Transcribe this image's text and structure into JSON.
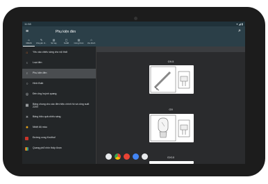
{
  "statusbar": {
    "time": "11:58",
    "icons": "▾ ◢ ▮"
  },
  "appbar": {
    "menu_glyph": "≡",
    "title": "Phụ kiện đèn",
    "search_glyph": "⌕"
  },
  "tabs": [
    {
      "icon": "⌂",
      "label": "Chính",
      "active": true
    },
    {
      "icon": "✎",
      "label": "Chuyển đ..."
    },
    {
      "icon": "▤",
      "label": "Sổ tay"
    },
    {
      "icon": "▢",
      "label": "Sơđồ"
    },
    {
      "icon": "▤",
      "label": "Công thức"
    },
    {
      "icon": "☆",
      "label": "Ưa thích"
    }
  ],
  "sidebar": {
    "items": [
      {
        "label": "Yêu cầu chiếu sáng cho nội thất",
        "icon_name": "house-icon",
        "color": "#e8742b"
      },
      {
        "label": "Loại đèn",
        "icon_name": "bulbs-icon",
        "color": "#cfd3d6"
      },
      {
        "label": "Phụ kiện đèn",
        "icon_name": "lamp-socket-icon",
        "color": "#cfd3d6",
        "selected": true
      },
      {
        "label": "Hình Bulb",
        "icon_name": "bulb-shape-icon",
        "color": "#cfd3d6"
      },
      {
        "label": "Đèn ống huỳnh quang",
        "icon_name": "fluorescent-tube-icon",
        "color": "#cfd3d6"
      },
      {
        "label": "Bảng chung cho các đèn hiệu chính hồ và công suất 220V",
        "icon_name": "table-icon",
        "color": "#cfd3d6"
      },
      {
        "label": "Bảng hiệu quả chiếu sáng",
        "icon_name": "efficiency-icon",
        "color": "#cfd3d6"
      },
      {
        "label": "Nhiệt độ màu",
        "icon_name": "color-temperature-icon",
        "color": "#e8a51a"
      },
      {
        "label": "Đường cong Kruithof",
        "icon_name": "curve-icon",
        "color": "#c8352a"
      },
      {
        "label": "Quang phổ nhìn thấy được",
        "icon_name": "spectrum-icon",
        "color": "#3ca35a"
      }
    ]
  },
  "content": {
    "sections": [
      {
        "label": "G9.5"
      },
      {
        "label": "G9"
      },
      {
        "label": "GX10"
      }
    ]
  }
}
